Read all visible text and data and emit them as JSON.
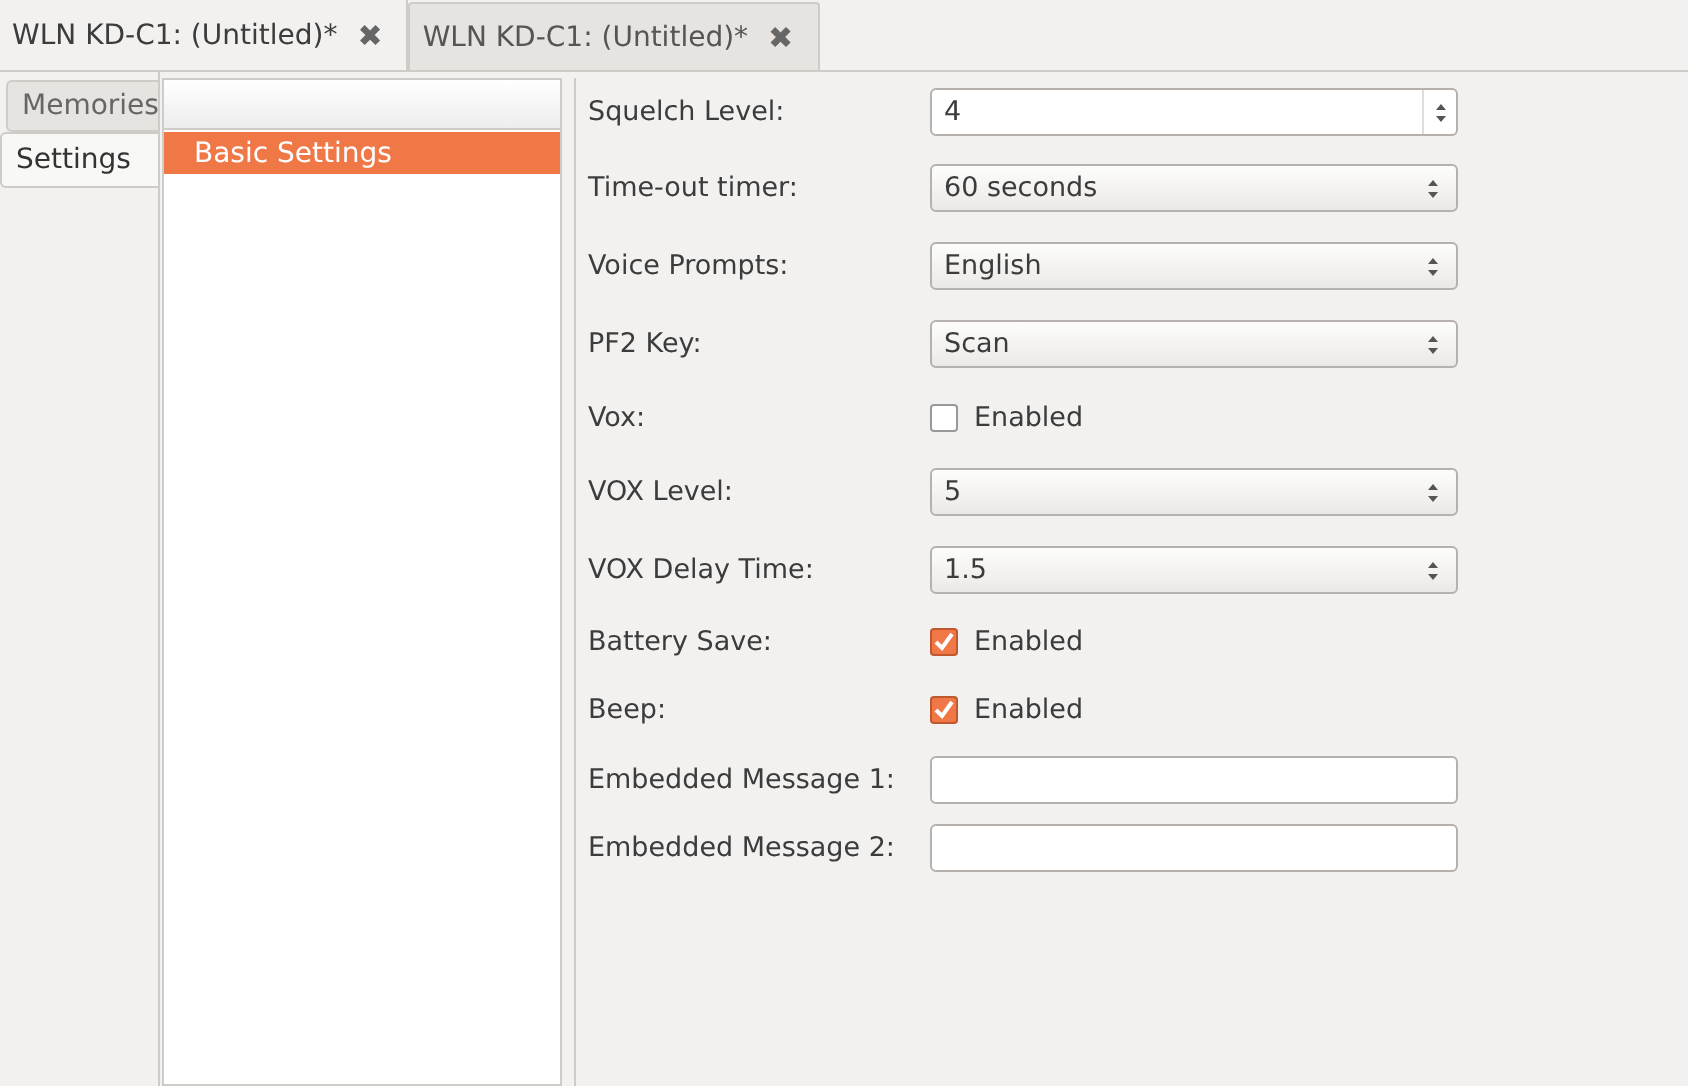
{
  "tabs": [
    {
      "label": "WLN KD-C1: (Untitled)*",
      "close": "✖",
      "selected": true
    },
    {
      "label": "WLN KD-C1: (Untitled)*",
      "close": "✖",
      "selected": false
    }
  ],
  "side_tabs": [
    {
      "label": "Memories",
      "selected": false
    },
    {
      "label": "Settings",
      "selected": true
    }
  ],
  "tree": {
    "items": [
      {
        "label": "Basic Settings",
        "selected": true
      }
    ]
  },
  "settings": [
    {
      "kind": "spin",
      "label": "Squelch Level:",
      "value": "4"
    },
    {
      "kind": "combo",
      "label": "Time-out timer:",
      "value": "60 seconds"
    },
    {
      "kind": "combo",
      "label": "Voice Prompts:",
      "value": "English"
    },
    {
      "kind": "combo",
      "label": "PF2 Key:",
      "value": "Scan"
    },
    {
      "kind": "check",
      "label": "Vox:",
      "text": "Enabled",
      "checked": false
    },
    {
      "kind": "combo",
      "label": "VOX Level:",
      "value": "5"
    },
    {
      "kind": "combo",
      "label": "VOX Delay Time:",
      "value": "1.5"
    },
    {
      "kind": "check",
      "label": "Battery Save:",
      "text": "Enabled",
      "checked": true
    },
    {
      "kind": "check",
      "label": "Beep:",
      "text": "Enabled",
      "checked": true
    },
    {
      "kind": "text",
      "label": "Embedded Message 1:"
    },
    {
      "kind": "text",
      "label": "Embedded Message 2:"
    }
  ]
}
